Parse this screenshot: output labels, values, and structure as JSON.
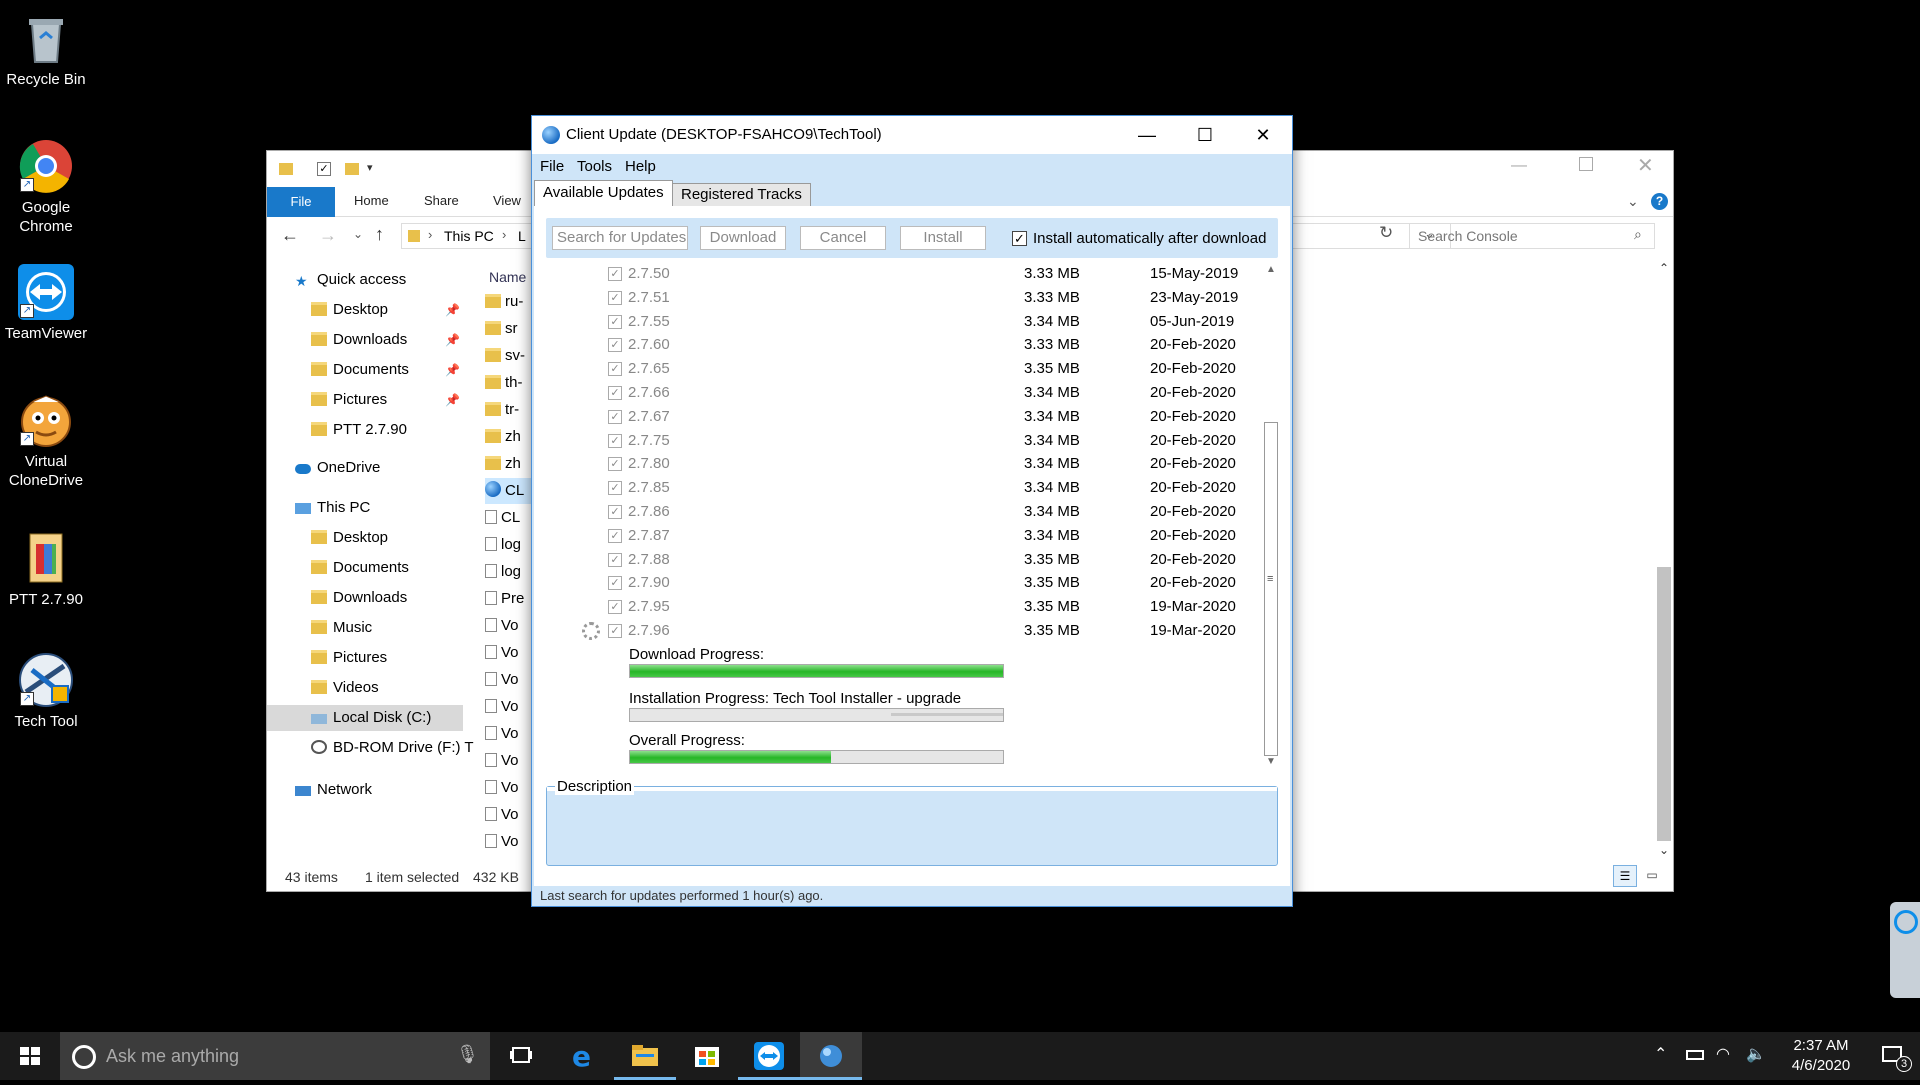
{
  "desktop_icons": [
    {
      "label": "Recycle Bin",
      "icon": "recycle-bin-icon"
    },
    {
      "label": "Google Chrome",
      "icon": "chrome-icon"
    },
    {
      "label": "TeamViewer",
      "icon": "teamviewer-icon"
    },
    {
      "label": "Virtual CloneDrive",
      "icon": "clonedrive-icon"
    },
    {
      "label": "PTT 2.7.90",
      "icon": "document-icon"
    },
    {
      "label": "Tech Tool",
      "icon": "techtool-icon"
    }
  ],
  "explorer": {
    "ribbon_tabs": [
      "File",
      "Home",
      "Share",
      "View"
    ],
    "address": {
      "this_pc": "This PC",
      "tail": "L"
    },
    "search_placeholder": "Search Console",
    "column_header": "Name",
    "nav": [
      {
        "label": "Quick access",
        "icon": "star-icon"
      },
      {
        "label": "Desktop",
        "icon": "folder-icon",
        "pinned": true
      },
      {
        "label": "Downloads",
        "icon": "download-folder-icon",
        "pinned": true
      },
      {
        "label": "Documents",
        "icon": "documents-folder-icon",
        "pinned": true
      },
      {
        "label": "Pictures",
        "icon": "pictures-folder-icon",
        "pinned": true
      },
      {
        "label": "PTT 2.7.90",
        "icon": "folder-icon"
      },
      {
        "label": "OneDrive",
        "icon": "cloud-icon"
      },
      {
        "label": "This PC",
        "icon": "computer-icon"
      },
      {
        "label": "Desktop",
        "icon": "folder-icon"
      },
      {
        "label": "Documents",
        "icon": "documents-folder-icon"
      },
      {
        "label": "Downloads",
        "icon": "download-folder-icon"
      },
      {
        "label": "Music",
        "icon": "music-folder-icon"
      },
      {
        "label": "Pictures",
        "icon": "pictures-folder-icon"
      },
      {
        "label": "Videos",
        "icon": "videos-folder-icon"
      },
      {
        "label": "Local Disk (C:)",
        "icon": "drive-icon"
      },
      {
        "label": "BD-ROM Drive (F:) T",
        "icon": "disc-icon"
      },
      {
        "label": "Network",
        "icon": "network-icon"
      }
    ],
    "files": [
      "ru-",
      "sr",
      "sv-",
      "th-",
      "tr-",
      "zh",
      "zh",
      "CL",
      "CL",
      "log",
      "log",
      "Pre",
      "Vo",
      "Vo",
      "Vo",
      "Vo",
      "Vo",
      "Vo",
      "Vo",
      "Vo",
      "Vo"
    ],
    "status": {
      "items": "43 items",
      "selected": "1 item selected",
      "size": "432 KB"
    }
  },
  "dialog": {
    "title": "Client Update (DESKTOP-FSAHCO9\\TechTool)",
    "menu": [
      "File",
      "Tools",
      "Help"
    ],
    "tabs": [
      "Available Updates",
      "Registered Tracks"
    ],
    "toolbar": {
      "search": "Search for Updates",
      "download": "Download",
      "cancel": "Cancel",
      "install": "Install",
      "auto_install": "Install automatically after download",
      "auto_install_checked": true
    },
    "updates": [
      {
        "version": "2.7.50",
        "size": "3.33 MB",
        "date": "15-May-2019"
      },
      {
        "version": "2.7.51",
        "size": "3.33 MB",
        "date": "23-May-2019"
      },
      {
        "version": "2.7.55",
        "size": "3.34 MB",
        "date": "05-Jun-2019"
      },
      {
        "version": "2.7.60",
        "size": "3.33 MB",
        "date": "20-Feb-2020"
      },
      {
        "version": "2.7.65",
        "size": "3.35 MB",
        "date": "20-Feb-2020"
      },
      {
        "version": "2.7.66",
        "size": "3.34 MB",
        "date": "20-Feb-2020"
      },
      {
        "version": "2.7.67",
        "size": "3.34 MB",
        "date": "20-Feb-2020"
      },
      {
        "version": "2.7.75",
        "size": "3.34 MB",
        "date": "20-Feb-2020"
      },
      {
        "version": "2.7.80",
        "size": "3.34 MB",
        "date": "20-Feb-2020"
      },
      {
        "version": "2.7.85",
        "size": "3.34 MB",
        "date": "20-Feb-2020"
      },
      {
        "version": "2.7.86",
        "size": "3.34 MB",
        "date": "20-Feb-2020"
      },
      {
        "version": "2.7.87",
        "size": "3.34 MB",
        "date": "20-Feb-2020"
      },
      {
        "version": "2.7.88",
        "size": "3.35 MB",
        "date": "20-Feb-2020"
      },
      {
        "version": "2.7.90",
        "size": "3.35 MB",
        "date": "20-Feb-2020"
      },
      {
        "version": "2.7.95",
        "size": "3.35 MB",
        "date": "19-Mar-2020"
      },
      {
        "version": "2.7.96",
        "size": "3.35 MB",
        "date": "19-Mar-2020",
        "in_progress": true
      }
    ],
    "progress": {
      "download_label": "Download Progress:",
      "download_fraction": 1.0,
      "install_label": "Installation Progress: Tech Tool Installer - upgrade",
      "install_fraction": 0.0,
      "overall_label": "Overall Progress:",
      "overall_fraction": 0.54
    },
    "description_label": "Description",
    "status": "Last search for updates performed 1 hour(s) ago."
  },
  "taskbar": {
    "search_placeholder": "Ask me anything",
    "time": "2:37 AM",
    "date": "4/6/2020",
    "notifications": "3"
  },
  "colors": {
    "dialog_bg": "#cfe5f8",
    "progress_green": "#27b627",
    "accent": "#1979ca"
  }
}
